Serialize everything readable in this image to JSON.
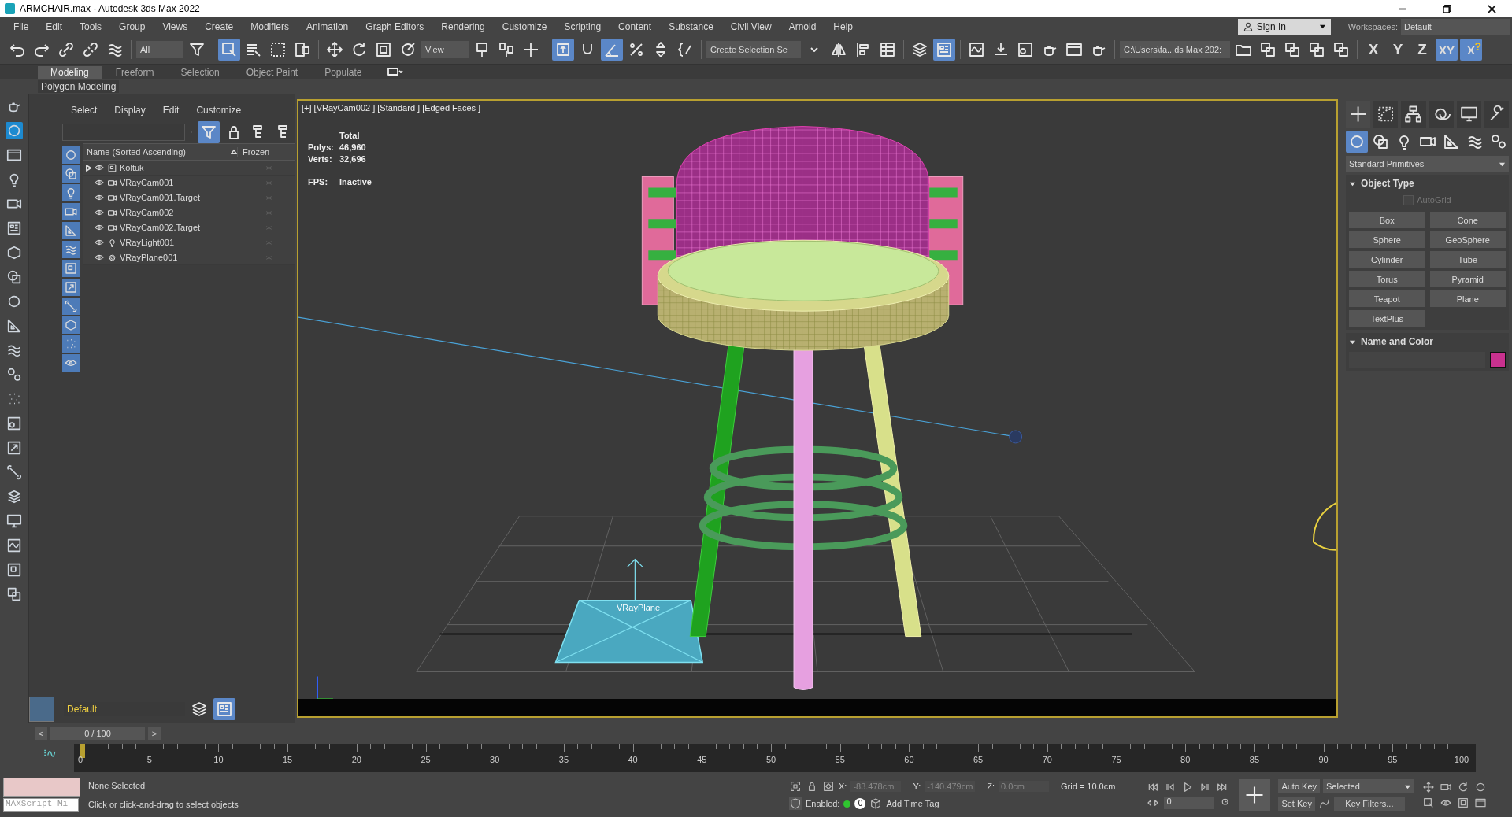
{
  "window": {
    "title": "ARMCHAIR.max - Autodesk 3ds Max 2022"
  },
  "menu": [
    "File",
    "Edit",
    "Tools",
    "Group",
    "Views",
    "Create",
    "Modifiers",
    "Animation",
    "Graph Editors",
    "Rendering",
    "Customize",
    "Scripting",
    "Content",
    "Substance",
    "Civil View",
    "Arnold",
    "Help"
  ],
  "account": {
    "sign_in": "Sign In",
    "workspaces_label": "Workspaces:",
    "workspace": "Default"
  },
  "toolbar": {
    "selection_filter": "All",
    "reference_coord": "View",
    "named_selection": "Create Selection Se",
    "project_path": "C:\\Users\\fa...ds Max 202:",
    "tools": [
      {
        "kind": "undo",
        "selected": false
      },
      {
        "kind": "redo",
        "selected": false
      },
      {
        "kind": "link",
        "selected": false
      },
      {
        "kind": "unlink",
        "selected": false
      },
      {
        "kind": "bind",
        "selected": false
      },
      {
        "kind": "filter",
        "selected": false
      },
      {
        "kind": "select",
        "selected": true
      },
      {
        "kind": "select_name",
        "selected": false
      },
      {
        "kind": "region",
        "selected": false
      },
      {
        "kind": "crossing",
        "selected": false
      },
      {
        "kind": "move",
        "selected": false
      },
      {
        "kind": "rotate",
        "selected": false
      },
      {
        "kind": "scale",
        "selected": false
      },
      {
        "kind": "place",
        "selected": false
      },
      {
        "kind": "coord",
        "selected": false
      },
      {
        "kind": "pivot",
        "selected": false
      },
      {
        "kind": "manipulate",
        "selected": false
      },
      {
        "kind": "keyboard",
        "selected": true
      },
      {
        "kind": "snap",
        "selected": false
      },
      {
        "kind": "angle",
        "selected": true
      },
      {
        "kind": "percent",
        "selected": false
      },
      {
        "kind": "spinner",
        "selected": false
      },
      {
        "kind": "braces",
        "selected": false
      },
      {
        "kind": "named",
        "selected": false
      },
      {
        "kind": "mirror",
        "selected": false
      },
      {
        "kind": "align",
        "selected": false
      },
      {
        "kind": "table",
        "selected": false
      },
      {
        "kind": "layers",
        "selected": false
      },
      {
        "kind": "explorer",
        "selected": true
      },
      {
        "kind": "curve",
        "selected": false
      },
      {
        "kind": "download",
        "selected": false
      },
      {
        "kind": "material",
        "selected": false
      },
      {
        "kind": "teapot",
        "selected": false
      },
      {
        "kind": "frame",
        "selected": false
      },
      {
        "kind": "teapot",
        "selected": false
      },
      {
        "kind": "path",
        "selected": false
      },
      {
        "kind": "stack",
        "selected": false
      },
      {
        "kind": "stack",
        "selected": false
      },
      {
        "kind": "stack",
        "selected": false
      },
      {
        "kind": "stack",
        "selected": false
      }
    ],
    "axes": [
      {
        "label": "X",
        "selected": false
      },
      {
        "label": "Y",
        "selected": false
      },
      {
        "label": "Z",
        "selected": false
      },
      {
        "label": "XY",
        "selected": true
      },
      {
        "label": "X",
        "selected": true,
        "badge": "?"
      }
    ]
  },
  "ribbon": {
    "tabs": [
      {
        "label": "Modeling",
        "selected": true
      },
      {
        "label": "Freeform",
        "selected": false
      },
      {
        "label": "Selection",
        "selected": false
      },
      {
        "label": "Object Paint",
        "selected": false
      },
      {
        "label": "Populate",
        "selected": false
      }
    ],
    "panel": "Polygon Modeling"
  },
  "scene_explorer": {
    "menu": [
      "Select",
      "Display",
      "Edit",
      "Customize"
    ],
    "columns": [
      "Name (Sorted Ascending)",
      "Frozen"
    ],
    "filters": [
      {
        "kind": "geometry",
        "on": true
      },
      {
        "kind": "shapes",
        "on": true
      },
      {
        "kind": "light",
        "on": true
      },
      {
        "kind": "camera",
        "on": true
      },
      {
        "kind": "helper",
        "on": true
      },
      {
        "kind": "waves",
        "on": true
      },
      {
        "kind": "group",
        "on": true
      },
      {
        "kind": "xref",
        "on": true
      },
      {
        "kind": "bone",
        "on": true
      },
      {
        "kind": "container",
        "on": true
      },
      {
        "kind": "particle",
        "on": true
      },
      {
        "kind": "visible",
        "on": true
      }
    ],
    "rows": [
      {
        "name": "Koltuk",
        "kind": "group",
        "expanded": false
      },
      {
        "name": "VRayCam001",
        "kind": "camera"
      },
      {
        "name": "VRayCam001.Target",
        "kind": "camera"
      },
      {
        "name": "VRayCam002",
        "kind": "camera"
      },
      {
        "name": "VRayCam002.Target",
        "kind": "camera"
      },
      {
        "name": "VRayLight001",
        "kind": "light"
      },
      {
        "name": "VRayPlane001",
        "kind": "plane"
      }
    ],
    "layer": "Default"
  },
  "viewport": {
    "label": "[+] [VRayCam002 ] [Standard ] [Edged Faces ]",
    "stats": [
      {
        "label": "Polys:",
        "value": "46,960"
      },
      {
        "label": "Verts:",
        "value": "32,696"
      }
    ],
    "stats_title": "Total",
    "fps_label": "FPS:",
    "fps": "Inactive",
    "plane_label": "VRayPlane"
  },
  "command_panel": {
    "tabs": [
      {
        "kind": "create",
        "selected": true
      },
      {
        "kind": "modify",
        "selected": false
      },
      {
        "kind": "hierarchy",
        "selected": false
      },
      {
        "kind": "motion",
        "selected": false
      },
      {
        "kind": "display",
        "selected": false
      },
      {
        "kind": "utilities",
        "selected": false
      }
    ],
    "categories": [
      {
        "kind": "geometry",
        "selected": true
      },
      {
        "kind": "shapes",
        "selected": false
      },
      {
        "kind": "light",
        "selected": false
      },
      {
        "kind": "camera",
        "selected": false
      },
      {
        "kind": "helper",
        "selected": false
      },
      {
        "kind": "waves",
        "selected": false
      },
      {
        "kind": "gears",
        "selected": false
      }
    ],
    "dropdown": "Standard Primitives",
    "object_type": "Object Type",
    "autogrid": {
      "label": "AutoGrid",
      "checked": false
    },
    "buttons": [
      "Box",
      "Cone",
      "Sphere",
      "GeoSphere",
      "Cylinder",
      "Tube",
      "Torus",
      "Pyramid",
      "Teapot",
      "Plane",
      "TextPlus"
    ],
    "name_color": "Name and Color"
  },
  "timeline": {
    "slider": "0 / 100",
    "prev": "<",
    "next": ">",
    "ticks": [
      "0",
      "5",
      "10",
      "15",
      "20",
      "25",
      "30",
      "35",
      "40",
      "45",
      "50",
      "55",
      "60",
      "65",
      "70",
      "75",
      "80",
      "85",
      "90",
      "95",
      "100"
    ]
  },
  "status": {
    "listener": "MAXScript Mi",
    "selection": "None Selected",
    "prompt": "Click or click-and-drag to select objects",
    "x_label": "X:",
    "x": "-83.478cm",
    "y_label": "Y:",
    "y": "-140.479cm",
    "z_label": "Z:",
    "z": "0.0cm",
    "grid": "Grid = 10.0cm",
    "enabled_label": "Enabled:",
    "enabled": true,
    "time_tag": "Add Time Tag",
    "counter": "0",
    "frame": "0",
    "auto_key": "Auto Key",
    "set_key": "Set Key",
    "key_mode": "Selected",
    "key_filters": "Key Filters..."
  }
}
